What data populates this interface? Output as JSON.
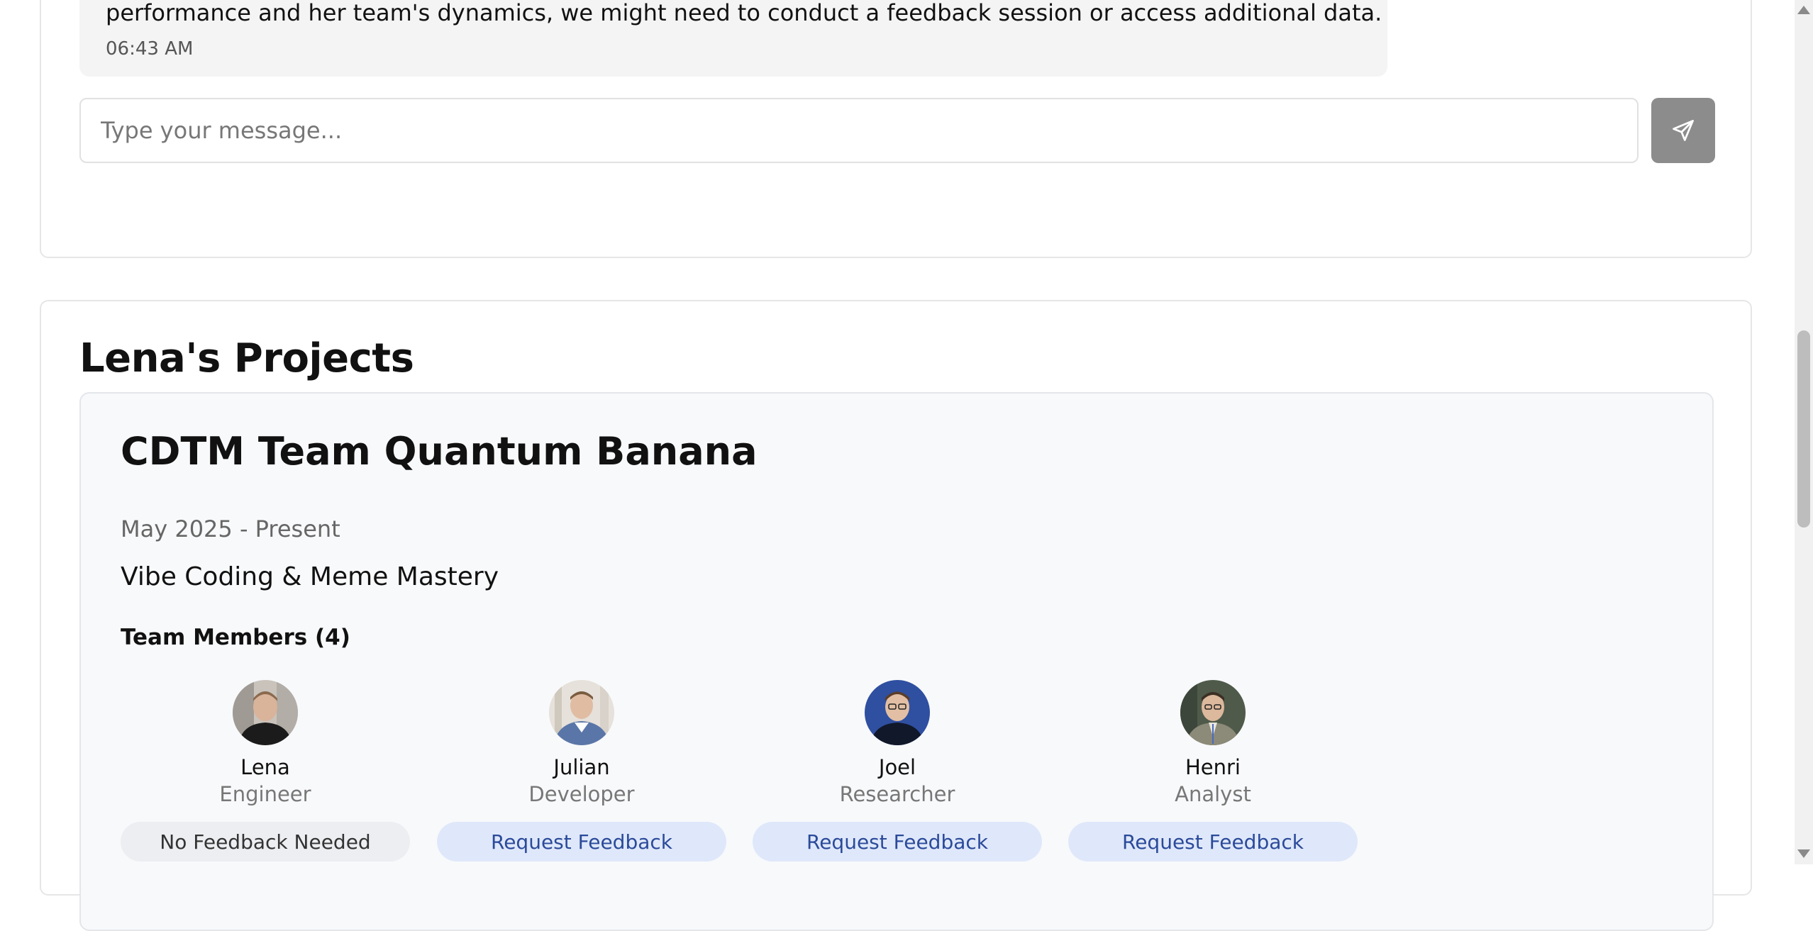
{
  "chat": {
    "last_message": {
      "text": "performance and her team's dynamics, we might need to conduct a feedback session or access additional data.",
      "time": "06:43 AM"
    },
    "input_placeholder": "Type your message...",
    "send_icon": "send-icon"
  },
  "projects": {
    "section_title": "Lena's Projects",
    "items": [
      {
        "name": "CDTM Team Quantum Banana",
        "dates": "May 2025 - Present",
        "description": "Vibe Coding & Meme Mastery",
        "team_heading": "Team Members (4)",
        "members": [
          {
            "name": "Lena",
            "role": "Engineer",
            "action": "No Feedback Needed",
            "action_enabled": false
          },
          {
            "name": "Julian",
            "role": "Developer",
            "action": "Request Feedback",
            "action_enabled": true
          },
          {
            "name": "Joel",
            "role": "Researcher",
            "action": "Request Feedback",
            "action_enabled": true
          },
          {
            "name": "Henri",
            "role": "Analyst",
            "action": "Request Feedback",
            "action_enabled": true
          }
        ]
      }
    ]
  },
  "colors": {
    "accent_button_bg": "#dfe8fa",
    "accent_button_text": "#2b4a9a",
    "send_button_bg": "#8c8c8c"
  }
}
